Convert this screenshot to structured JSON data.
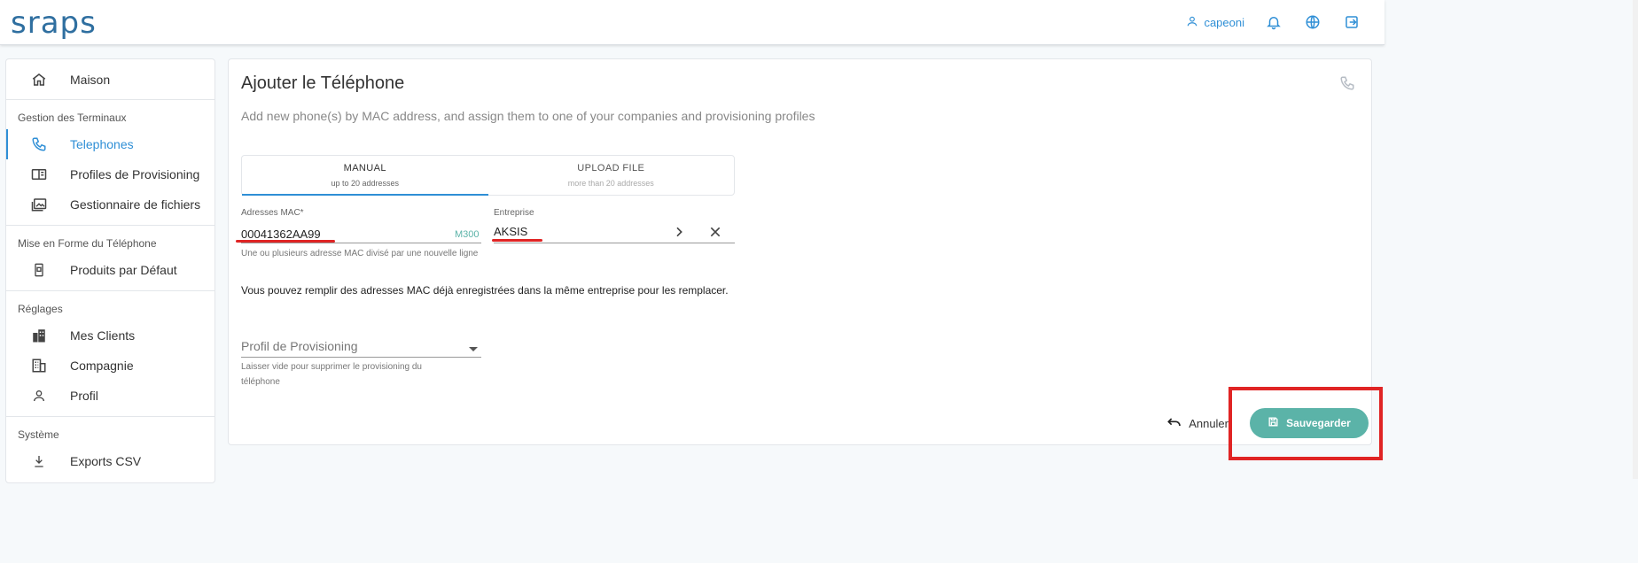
{
  "header": {
    "logo": "sraps",
    "username": "capeoni",
    "icons": [
      "user-icon",
      "bell-icon",
      "globe-icon",
      "logout-icon"
    ]
  },
  "sidebar": {
    "home": {
      "label": "Maison",
      "icon": "home-icon"
    },
    "sections": [
      {
        "title": "Gestion des Terminaux",
        "items": [
          {
            "label": "Telephones",
            "icon": "phone-icon",
            "active": true
          },
          {
            "label": "Profiles de Provisioning",
            "icon": "book-icon"
          },
          {
            "label": "Gestionnaire de fichiers",
            "icon": "images-icon"
          }
        ]
      },
      {
        "title": "Mise en Forme du Téléphone",
        "items": [
          {
            "label": "Produits par Défaut",
            "icon": "device-icon"
          }
        ]
      },
      {
        "title": "Réglages",
        "items": [
          {
            "label": "Mes Clients",
            "icon": "city-icon"
          },
          {
            "label": "Compagnie",
            "icon": "building-icon"
          },
          {
            "label": "Profil",
            "icon": "person-icon"
          }
        ]
      },
      {
        "title": "Système",
        "items": [
          {
            "label": "Exports CSV",
            "icon": "download-icon"
          }
        ]
      }
    ]
  },
  "main": {
    "title": "Ajouter le Téléphone",
    "subtitle": "Add new phone(s) by MAC address, and assign them to one of your companies and provisioning profiles",
    "tabs": [
      {
        "label": "MANUAL",
        "sublabel": "up to 20 addresses",
        "active": true
      },
      {
        "label": "UPLOAD FILE",
        "sublabel": "more than 20 addresses",
        "active": false
      }
    ],
    "mac_field": {
      "label": "Adresses MAC*",
      "value": "00041362AA99",
      "model": "M300",
      "hint": "Une ou plusieurs adresse MAC divisé par une nouvelle ligne"
    },
    "company_field": {
      "label": "Entreprise",
      "value": "AKSIS"
    },
    "info": "Vous pouvez remplir des adresses MAC déjà enregistrées dans la même entreprise pour les remplacer.",
    "profile_field": {
      "placeholder": "Profil de Provisioning",
      "hint": "Laisser vide pour supprimer le provisioning du téléphone"
    },
    "actions": {
      "cancel": "Annuler",
      "save": "Sauvegarder"
    }
  },
  "colors": {
    "accent": "#2f8fd6",
    "save_button": "#5bb3a8",
    "annotation_red": "#e02424"
  }
}
